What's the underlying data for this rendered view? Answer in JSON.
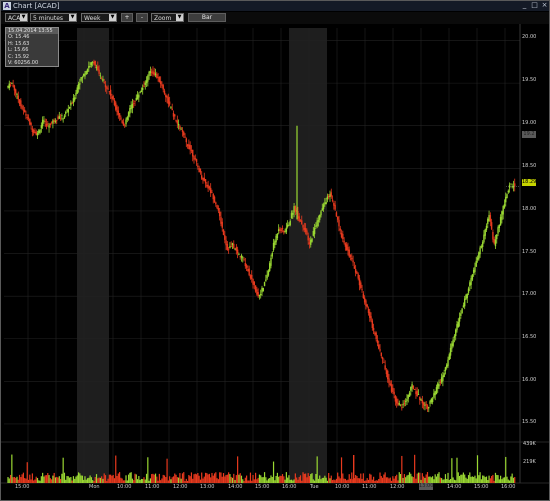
{
  "window": {
    "title": "Chart [ACAD]"
  },
  "toolbar": {
    "symbol": "ACAD",
    "interval": "5 minutes",
    "range": "Week",
    "plus_label": "+",
    "minus_label": "-",
    "zoom": "Zoom",
    "bar_label": "Bar"
  },
  "ohlc_box": {
    "header": "15.04.2014 13:55",
    "open": "O: 15.46",
    "high": "H: 15.63",
    "low": "L: 15.66",
    "close": "C: 15.92",
    "volume": "V: 60256.00"
  },
  "price_axis": {
    "ticks": [
      "20.00",
      "19.50",
      "19.00",
      "18.50",
      "18.00",
      "17.50",
      "17.00",
      "16.50",
      "16.00",
      "15.50"
    ],
    "current_price": "18.29",
    "hover_price": "19.2"
  },
  "volume_axis": {
    "ticks": [
      "439K",
      "219K"
    ]
  },
  "time_axis": {
    "labels": [
      "15:00",
      "Mon",
      "10:00",
      "11:00",
      "12:00",
      "13:00",
      "14:00",
      "15:00",
      "16:00",
      "Tue",
      "10:00",
      "11:00",
      "12:00",
      "13:00",
      "14:00",
      "15:00",
      "16:00"
    ],
    "hover_time": "13:00"
  },
  "colors": {
    "up": "#9ad832",
    "down": "#e83a1e",
    "shade": "#1e1e1e",
    "grid": "#222222"
  },
  "chart_data": {
    "type": "candlestick",
    "title": "",
    "x_labels": [
      "15:00",
      "Mon",
      "10:00",
      "11:00",
      "12:00",
      "13:00",
      "14:00",
      "15:00",
      "16:00",
      "Tue",
      "10:00",
      "11:00",
      "12:00",
      "13:00",
      "14:00",
      "15:00",
      "16:00"
    ],
    "ylim": [
      15.3,
      20.1
    ],
    "y_ticks": [
      20.0,
      19.5,
      19.0,
      18.5,
      18.0,
      17.5,
      17.0,
      16.5,
      16.0,
      15.5
    ],
    "price_path": [
      19.45,
      19.5,
      19.35,
      19.2,
      19.1,
      18.95,
      18.9,
      19.05,
      19.0,
      19.05,
      19.1,
      19.1,
      19.2,
      19.3,
      19.5,
      19.6,
      19.7,
      19.75,
      19.6,
      19.5,
      19.4,
      19.25,
      19.1,
      19.0,
      19.2,
      19.3,
      19.4,
      19.5,
      19.65,
      19.6,
      19.5,
      19.35,
      19.2,
      19.05,
      18.95,
      18.8,
      18.7,
      18.55,
      18.4,
      18.3,
      18.2,
      18.05,
      17.8,
      17.55,
      17.6,
      17.5,
      17.45,
      17.3,
      17.15,
      17.0,
      17.1,
      17.3,
      17.6,
      17.8,
      17.75,
      17.85,
      18.05,
      17.9,
      17.8,
      17.6,
      17.8,
      17.95,
      18.1,
      18.2,
      18.0,
      17.75,
      17.6,
      17.45,
      17.3,
      17.1,
      16.9,
      16.7,
      16.5,
      16.3,
      16.1,
      15.9,
      15.75,
      15.7,
      15.8,
      15.95,
      15.85,
      15.75,
      15.7,
      15.8,
      15.95,
      16.05,
      16.25,
      16.5,
      16.7,
      16.9,
      17.1,
      17.3,
      17.5,
      17.7,
      17.95,
      17.6,
      17.85,
      18.1,
      18.3,
      18.3
    ],
    "volume_ticks": [
      "439K",
      "219K"
    ]
  }
}
